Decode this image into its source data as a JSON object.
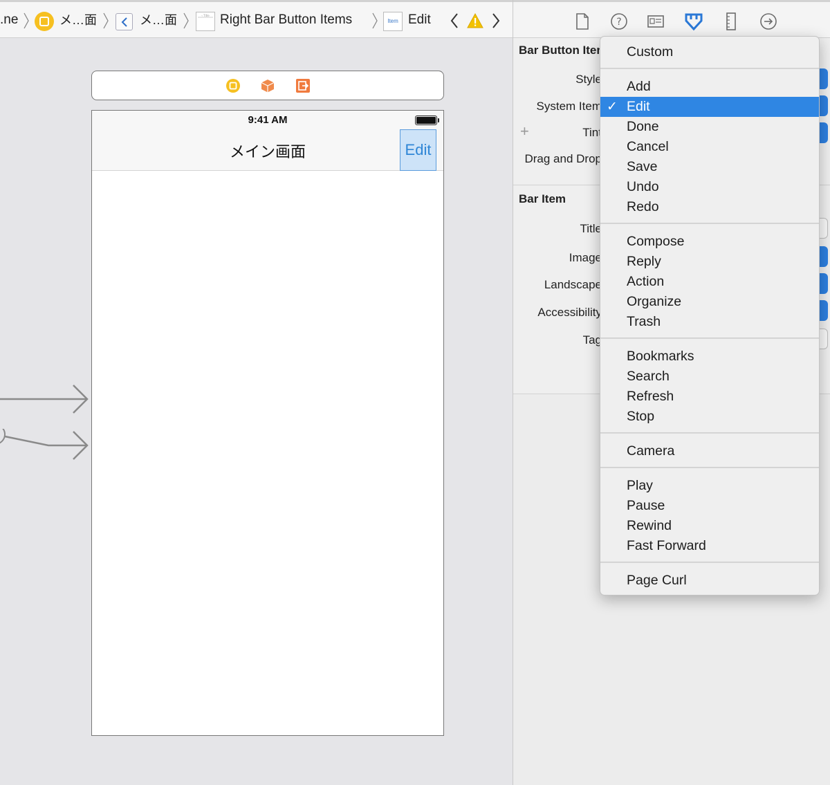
{
  "breadcrumb": {
    "items": [
      ".ne",
      "メ…面",
      "メ…面",
      "Right Bar Button Items",
      "Edit"
    ],
    "colors": {
      "scene_icon": "#f6c021",
      "warning": "#f3c200",
      "link": "#2f86d6"
    }
  },
  "canvas": {
    "dock_icons": [
      "view-controller-icon",
      "first-responder-icon",
      "exit-icon"
    ],
    "phone": {
      "status_time": "9:41 AM",
      "nav_title": "メイン画面",
      "edit_button": "Edit"
    }
  },
  "inspector": {
    "tabs": [
      "file-icon",
      "help-icon",
      "identity-icon",
      "attributes-icon",
      "size-icon",
      "connections-icon"
    ],
    "section1": {
      "title": "Bar Button Item",
      "props": [
        "Style",
        "System Item",
        "Tint",
        "Drag and Drop"
      ]
    },
    "section2": {
      "title": "Bar Item",
      "props": [
        "Title",
        "Image",
        "Landscape",
        "Accessibility",
        "Tag"
      ]
    }
  },
  "menu": {
    "selected": "Edit",
    "groups": [
      [
        "Custom"
      ],
      [
        "Add",
        "Edit",
        "Done",
        "Cancel",
        "Save",
        "Undo",
        "Redo"
      ],
      [
        "Compose",
        "Reply",
        "Action",
        "Organize",
        "Trash"
      ],
      [
        "Bookmarks",
        "Search",
        "Refresh",
        "Stop"
      ],
      [
        "Camera"
      ],
      [
        "Play",
        "Pause",
        "Rewind",
        "Fast Forward"
      ],
      [
        "Page Curl"
      ]
    ]
  }
}
